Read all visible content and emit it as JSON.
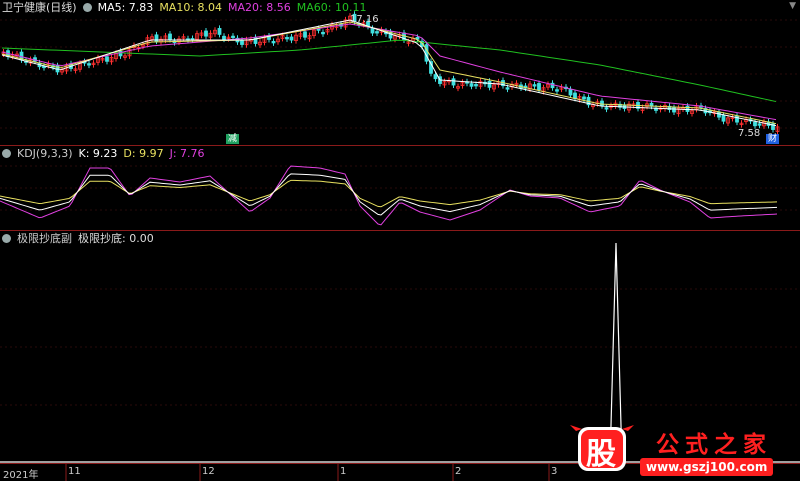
{
  "price_panel": {
    "title": "卫宁健康(日线)",
    "indicators": [
      {
        "label": "MA5: 7.83",
        "color": "#ffffff"
      },
      {
        "label": "MA10: 8.04",
        "color": "#e8e060"
      },
      {
        "label": "MA20: 8.56",
        "color": "#e040e0"
      },
      {
        "label": "MA60: 10.11",
        "color": "#20c020"
      }
    ],
    "high_label": "17.16",
    "low_label": "7.58",
    "reduce_tag": "减",
    "finance_tag": "财"
  },
  "kdj_panel": {
    "title": "KDJ(9,3,3)",
    "values": [
      {
        "label": "K: 9.23",
        "color": "#ffffff"
      },
      {
        "label": "D: 9.97",
        "color": "#e8e060"
      },
      {
        "label": "J: 7.76",
        "color": "#e040e0"
      }
    ]
  },
  "bottom_panel": {
    "title": "极限抄底副",
    "value_label": "极限抄底: 0.00"
  },
  "x_axis": {
    "labels": [
      "2021年",
      "11",
      "12",
      "1",
      "2",
      "3"
    ]
  },
  "watermark": {
    "logo_char": "股",
    "brand": "公式之家",
    "url": "www.gszj100.com"
  },
  "colors": {
    "up": "#ff3030",
    "down": "#40e0e0",
    "separator": "#8a1a1a"
  }
}
